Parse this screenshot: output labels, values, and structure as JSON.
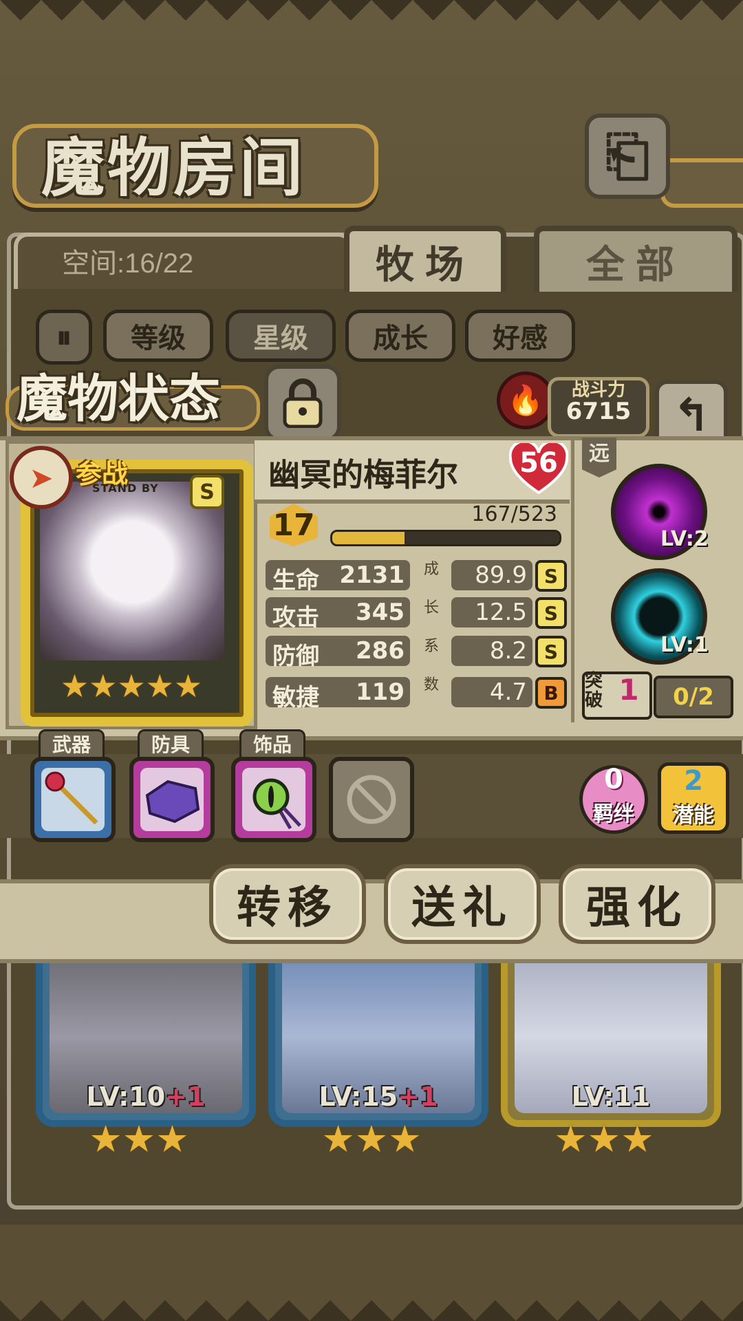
{
  "header": {
    "title": "魔物房间"
  },
  "tabs": {
    "space_label": "空间:16/22",
    "ranch": "牧场",
    "all": "全部"
  },
  "filters": {
    "level": "等级",
    "star": "星级",
    "growth": "成长",
    "affection": "好感"
  },
  "status": {
    "title": "魔物状态",
    "power_label": "战斗力",
    "power_value": "6715"
  },
  "monster": {
    "standby": "参战",
    "standby_sub": "STAND BY",
    "rank": "S",
    "name": "幽冥的梅菲尔",
    "affection": "56",
    "level": "17",
    "exp_text": "167/523",
    "exp_progress": 0.319,
    "star_count": 5,
    "stats": [
      {
        "label": "生命",
        "value": "2131",
        "growth": "89.9",
        "grade": "S"
      },
      {
        "label": "攻击",
        "value": "345",
        "growth": "12.5",
        "grade": "S"
      },
      {
        "label": "防御",
        "value": "286",
        "growth": "8.2",
        "grade": "S"
      },
      {
        "label": "敏捷",
        "value": "119",
        "growth": "4.7",
        "grade": "B"
      }
    ],
    "growth_caption": [
      "成",
      "长",
      "系",
      "数"
    ],
    "range": "远",
    "skills": [
      {
        "level": "LV:2",
        "color": "#c030d0"
      },
      {
        "level": "LV:1",
        "color": "#30d0e0"
      }
    ],
    "breakthrough": {
      "label": "突破",
      "value": "1",
      "progress": "0/2"
    }
  },
  "equipment": {
    "weapon": "武器",
    "armor": "防具",
    "accessory": "饰品"
  },
  "side": {
    "bond_num": "0",
    "bond_label": "羁绊",
    "potential_num": "2",
    "potential_label": "潜能"
  },
  "actions": {
    "transfer": "转移",
    "gift": "送礼",
    "enhance": "强化"
  },
  "cards": [
    {
      "level": "LV:10",
      "plus": "+1",
      "stars": 3
    },
    {
      "level": "LV:15",
      "plus": "+1",
      "stars": 3
    },
    {
      "level": "LV:11",
      "plus": "",
      "stars": 3
    }
  ],
  "colors": {
    "accent_gold": "#e2b83c",
    "panel": "#cbc2a3",
    "affection_red": "#d02a3a"
  }
}
